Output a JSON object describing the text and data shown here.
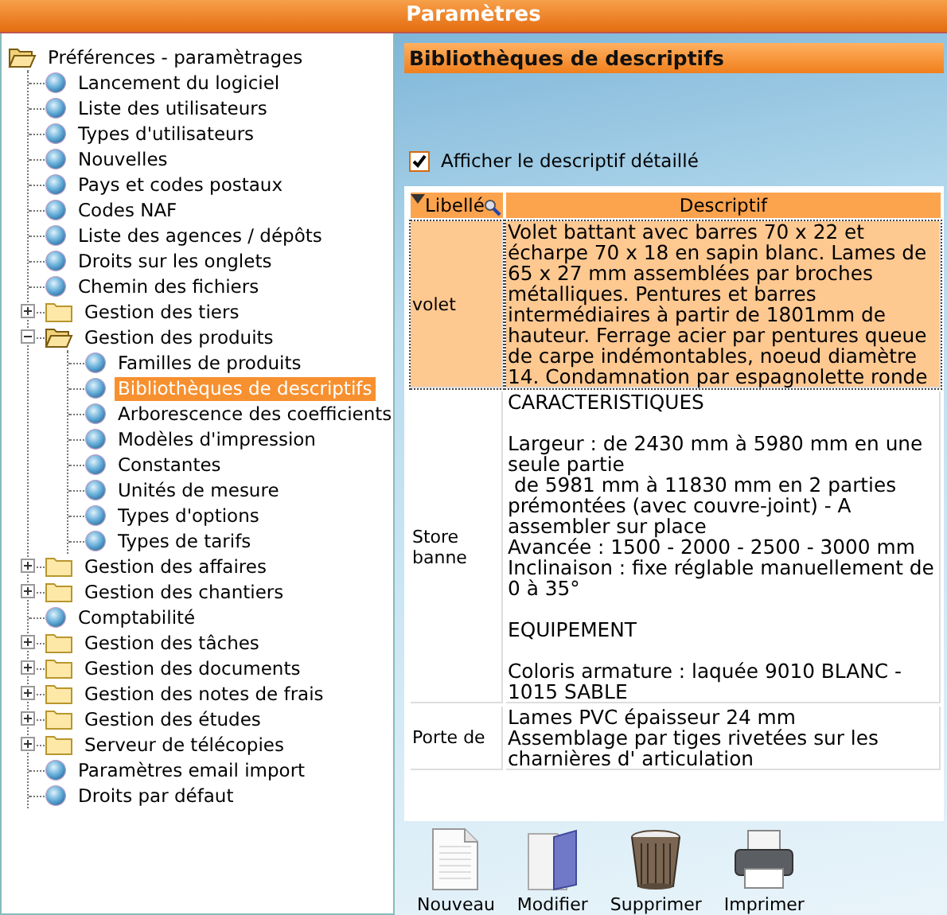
{
  "window": {
    "title": "Paramètres"
  },
  "tree": [
    {
      "label": "Préférences - paramètrages",
      "kind": "folder",
      "expanded": true,
      "root": true,
      "selected": false,
      "children": [
        {
          "label": "Lancement du logiciel",
          "kind": "leaf",
          "selected": false
        },
        {
          "label": "Liste des utilisateurs",
          "kind": "leaf",
          "selected": false
        },
        {
          "label": "Types d'utilisateurs",
          "kind": "leaf",
          "selected": false
        },
        {
          "label": "Nouvelles",
          "kind": "leaf",
          "selected": false
        },
        {
          "label": "Pays et codes postaux",
          "kind": "leaf",
          "selected": false
        },
        {
          "label": "Codes NAF",
          "kind": "leaf",
          "selected": false
        },
        {
          "label": "Liste des agences / dépôts",
          "kind": "leaf",
          "selected": false
        },
        {
          "label": "Droits sur les onglets",
          "kind": "leaf",
          "selected": false
        },
        {
          "label": "Chemin des fichiers",
          "kind": "leaf",
          "selected": false
        },
        {
          "label": "Gestion des tiers",
          "kind": "folder",
          "expanded": false,
          "selected": false
        },
        {
          "label": "Gestion des produits",
          "kind": "folder",
          "expanded": true,
          "selected": false,
          "children": [
            {
              "label": "Familles de produits",
              "kind": "leaf",
              "selected": false
            },
            {
              "label": "Bibliothèques de descriptifs",
              "kind": "leaf",
              "selected": true
            },
            {
              "label": "Arborescence des coefficients",
              "kind": "leaf",
              "selected": false
            },
            {
              "label": "Modèles d'impression",
              "kind": "leaf",
              "selected": false
            },
            {
              "label": "Constantes",
              "kind": "leaf",
              "selected": false
            },
            {
              "label": "Unités de mesure",
              "kind": "leaf",
              "selected": false
            },
            {
              "label": "Types d'options",
              "kind": "leaf",
              "selected": false
            },
            {
              "label": "Types de tarifs",
              "kind": "leaf",
              "selected": false
            }
          ]
        },
        {
          "label": "Gestion des affaires",
          "kind": "folder",
          "expanded": false,
          "selected": false
        },
        {
          "label": "Gestion des chantiers",
          "kind": "folder",
          "expanded": false,
          "selected": false
        },
        {
          "label": "Comptabilité",
          "kind": "leaf",
          "selected": false
        },
        {
          "label": "Gestion des tâches",
          "kind": "folder",
          "expanded": false,
          "selected": false
        },
        {
          "label": "Gestion des documents",
          "kind": "folder",
          "expanded": false,
          "selected": false
        },
        {
          "label": "Gestion des notes de frais",
          "kind": "folder",
          "expanded": false,
          "selected": false
        },
        {
          "label": "Gestion des études",
          "kind": "folder",
          "expanded": false,
          "selected": false
        },
        {
          "label": "Serveur de télécopies",
          "kind": "folder",
          "expanded": false,
          "selected": false
        },
        {
          "label": "Paramètres email import",
          "kind": "leaf",
          "selected": false
        },
        {
          "label": "Droits par défaut",
          "kind": "leaf",
          "selected": false
        }
      ]
    }
  ],
  "panel": {
    "title": "Bibliothèques de descriptifs"
  },
  "option": {
    "label": "Afficher le descriptif détaillé",
    "checked": true
  },
  "table": {
    "columns": [
      "Libellé",
      "Descriptif"
    ],
    "rows": [
      {
        "libelle": "volet",
        "descriptif": "Volet battant avec barres 70 x 22 et écharpe 70 x 18 en sapin blanc. Lames de 65 x 27 mm assemblées par broches métalliques. Pentures et barres intermédiaires à partir de 1801mm de hauteur. Ferrage acier par pentures queue de carpe indémontables, noeud diamètre 14. Condamnation par espagnolette ronde",
        "selected": true
      },
      {
        "libelle": "Store banne",
        "descriptif": "CARACTERISTIQUES\n\nLargeur : de 2430 mm à 5980 mm en une seule partie\n de 5981 mm à 11830 mm en 2 parties prémontées (avec couvre-joint) - A assembler sur place\nAvancée : 1500 - 2000 - 2500 - 3000 mm\nInclinaison : fixe réglable manuellement de 0 à 35°\n\nEQUIPEMENT\n\nColoris armature : laquée 9010 BLANC - 1015 SABLE",
        "selected": false
      },
      {
        "libelle": "Porte de",
        "descriptif": "Lames PVC épaisseur 24 mm\nAssemblage par tiges rivetées sur les charnières d' articulation",
        "selected": false
      }
    ]
  },
  "toolbar": [
    {
      "label": "Nouveau",
      "kind": "new"
    },
    {
      "label": "Modifier",
      "kind": "edit"
    },
    {
      "label": "Supprimer",
      "kind": "delete"
    },
    {
      "label": "Imprimer",
      "kind": "print"
    }
  ]
}
